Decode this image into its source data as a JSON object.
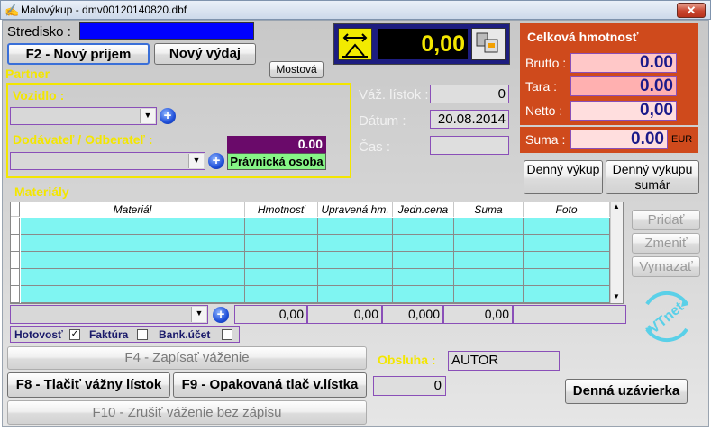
{
  "window": {
    "title": "Malovýkup - dmv00120140820.dbf",
    "close_symbol": "✕",
    "app_icon_glyph": "✍"
  },
  "header": {
    "stredisko_label": "Stredisko :",
    "stredisko_value": "",
    "btn_f2": "F2 - Nový príjem",
    "btn_novy_vydaj": "Nový výdaj",
    "btn_mostova": "Mostová"
  },
  "display": {
    "value": "0,00"
  },
  "partner": {
    "section_title": "Partner",
    "vozidlo_label": "Vozidlo :",
    "dodavatel_label": "Dodávateľ / Odberateľ :",
    "amount": "0.00",
    "pravnicka": "Právnická osoba"
  },
  "listok": {
    "vaz_label": "Váž. lístok :",
    "vaz_value": "0",
    "datum_label": "Dátum :",
    "datum_value": "20.08.2014",
    "cas_label": "Čas :",
    "cas_value": ""
  },
  "weights": {
    "title": "Celková hmotnosť",
    "brutto_label": "Brutto :",
    "brutto": "0.00",
    "tara_label": "Tara :",
    "tara": "0.00",
    "netto_label": "Netto :",
    "netto": "0,00",
    "suma_label": "Suma :",
    "suma": "0.00",
    "currency": "EUR"
  },
  "side_buttons": {
    "denny_vykup": "Denný výkup",
    "denny_vykupu_sumar": "Denný vykupu sumár",
    "pridat": "Pridať",
    "zmenit": "Zmeniť",
    "vymazat": "Vymazať"
  },
  "materials": {
    "section_title": "Materiály",
    "columns": [
      "Materiál",
      "Hmotnosť",
      "Upravená hm.",
      "Jedn.cena",
      "Suma",
      "Foto"
    ],
    "totals": {
      "hmotnost": "0,00",
      "upravena": "0,00",
      "jedn_cena": "0,000",
      "suma": "0,00"
    }
  },
  "payment": {
    "hotovost": "Hotovosť",
    "faktura": "Faktúra",
    "bank": "Bank.účet"
  },
  "actions": {
    "f4": "F4 - Zapísať váženie",
    "f8": "F8 - Tlačiť vážny lístok",
    "f9": "F9 - Opakovaná tlač v.lístka",
    "f10": "F10 - Zrušiť váženie bez zápisu",
    "obsluha_label": "Obsluha :",
    "obsluha_value": "AUTOR",
    "counter": "0",
    "denna_uzavierka": "Denná uzávierka"
  },
  "logo_text": "VTnet",
  "colors": {
    "accent_yellow": "#f3e600",
    "weight_panel": "#cf4a1c",
    "grid_cyan": "#7ff5f2",
    "display_bg": "#1d1d80"
  }
}
